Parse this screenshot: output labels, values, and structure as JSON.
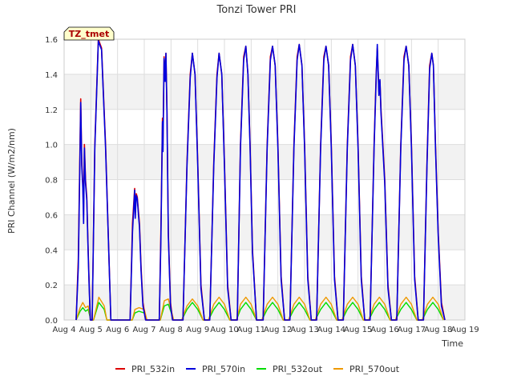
{
  "chart_data": {
    "type": "line",
    "title": "Tonzi Tower PRI",
    "xlabel": "Time",
    "ylabel": "PRI Channel (W/m2/nm)",
    "badge": "TZ_tmet",
    "xlim": [
      4,
      19
    ],
    "ylim": [
      0,
      1.6
    ],
    "x_ticks": [
      {
        "v": 4,
        "label": "Aug 4"
      },
      {
        "v": 5,
        "label": "Aug 5"
      },
      {
        "v": 6,
        "label": "Aug 6"
      },
      {
        "v": 7,
        "label": "Aug 7"
      },
      {
        "v": 8,
        "label": "Aug 8"
      },
      {
        "v": 9,
        "label": "Aug 9"
      },
      {
        "v": 10,
        "label": "Aug 10"
      },
      {
        "v": 11,
        "label": "Aug 11"
      },
      {
        "v": 12,
        "label": "Aug 12"
      },
      {
        "v": 13,
        "label": "Aug 13"
      },
      {
        "v": 14,
        "label": "Aug 14"
      },
      {
        "v": 15,
        "label": "Aug 15"
      },
      {
        "v": 16,
        "label": "Aug 16"
      },
      {
        "v": 17,
        "label": "Aug 17"
      },
      {
        "v": 18,
        "label": "Aug 18"
      },
      {
        "v": 19,
        "label": "Aug 19"
      }
    ],
    "y_ticks": [
      {
        "v": 0.0,
        "label": "0.0"
      },
      {
        "v": 0.2,
        "label": "0.2"
      },
      {
        "v": 0.4,
        "label": "0.4"
      },
      {
        "v": 0.6,
        "label": "0.6"
      },
      {
        "v": 0.8,
        "label": "0.8"
      },
      {
        "v": 1.0,
        "label": "1.0"
      },
      {
        "v": 1.2,
        "label": "1.2"
      },
      {
        "v": 1.4,
        "label": "1.4"
      },
      {
        "v": 1.6,
        "label": "1.6"
      }
    ],
    "grid": true,
    "legend_position": "bottom",
    "series": [
      {
        "name": "PRI_532in",
        "color": "#dd0000",
        "x": [
          4.45,
          4.53,
          4.6,
          4.62,
          4.66,
          4.7,
          4.73,
          4.76,
          4.8,
          4.85,
          4.9,
          4.94,
          4.98,
          5.05,
          5.15,
          5.28,
          5.4,
          5.55,
          5.75,
          5.9,
          6.02,
          6.15,
          6.47,
          6.56,
          6.64,
          6.66,
          6.7,
          6.74,
          6.78,
          6.82,
          6.88,
          6.95,
          7.05,
          7.56,
          7.62,
          7.68,
          7.7,
          7.74,
          7.78,
          7.81,
          7.85,
          7.9,
          7.98,
          8.06,
          8.45,
          8.6,
          8.72,
          8.8,
          8.9,
          9.0,
          9.12,
          9.25,
          9.45,
          9.6,
          9.72,
          9.8,
          9.9,
          10.0,
          10.12,
          10.25,
          10.48,
          10.6,
          10.72,
          10.8,
          10.88,
          10.96,
          11.05,
          11.2,
          11.45,
          11.6,
          11.72,
          11.8,
          11.9,
          12.0,
          12.12,
          12.25,
          12.45,
          12.6,
          12.72,
          12.8,
          12.9,
          13.0,
          13.12,
          13.25,
          13.45,
          13.6,
          13.72,
          13.8,
          13.9,
          14.0,
          14.12,
          14.25,
          14.45,
          14.6,
          14.72,
          14.8,
          14.9,
          15.0,
          15.12,
          15.25,
          15.45,
          15.6,
          15.68,
          15.72,
          15.78,
          15.82,
          15.86,
          16.0,
          16.12,
          16.25,
          16.45,
          16.6,
          16.72,
          16.8,
          16.9,
          17.0,
          17.12,
          17.25,
          17.45,
          17.58,
          17.68,
          17.76,
          17.82,
          17.9,
          18.0,
          18.12,
          18.25
        ],
        "y": [
          0,
          0.35,
          1.05,
          1.26,
          0.9,
          0.78,
          0.6,
          1.0,
          0.8,
          0.7,
          0.4,
          0.2,
          0,
          0,
          1.0,
          1.6,
          1.55,
          1.0,
          0,
          0,
          0,
          0,
          0,
          0.55,
          0.75,
          0.6,
          0.72,
          0.7,
          0.62,
          0.55,
          0.3,
          0.1,
          0,
          0,
          0.5,
          1.15,
          1.0,
          1.5,
          1.38,
          1.52,
          1.2,
          0.5,
          0.1,
          0,
          0,
          0.9,
          1.4,
          1.52,
          1.4,
          0.9,
          0.2,
          0,
          0,
          0.9,
          1.4,
          1.52,
          1.4,
          0.9,
          0.2,
          0,
          0,
          1.0,
          1.5,
          1.56,
          1.4,
          1.0,
          0.4,
          0,
          0,
          1.0,
          1.5,
          1.56,
          1.45,
          1.0,
          0.25,
          0,
          0,
          1.0,
          1.5,
          1.57,
          1.45,
          1.0,
          0.25,
          0,
          0,
          1.0,
          1.5,
          1.56,
          1.45,
          1.0,
          0.25,
          0,
          0,
          1.0,
          1.5,
          1.57,
          1.45,
          1.0,
          0.25,
          0,
          0,
          1.0,
          1.4,
          1.55,
          1.3,
          1.36,
          1.2,
          0.8,
          0.2,
          0,
          0,
          1.0,
          1.5,
          1.56,
          1.45,
          1.0,
          0.25,
          0,
          0,
          0.9,
          1.45,
          1.52,
          1.45,
          1.0,
          0.5,
          0.1,
          0
        ]
      },
      {
        "name": "PRI_570in",
        "color": "#0000dd",
        "x": [
          4.45,
          4.53,
          4.6,
          4.62,
          4.66,
          4.7,
          4.73,
          4.76,
          4.8,
          4.85,
          4.9,
          4.94,
          4.98,
          5.05,
          5.15,
          5.28,
          5.4,
          5.55,
          5.75,
          5.9,
          6.02,
          6.15,
          6.47,
          6.56,
          6.64,
          6.66,
          6.7,
          6.74,
          6.78,
          6.82,
          6.88,
          6.95,
          7.05,
          7.56,
          7.62,
          7.68,
          7.7,
          7.74,
          7.78,
          7.81,
          7.85,
          7.9,
          7.98,
          8.06,
          8.45,
          8.6,
          8.72,
          8.8,
          8.9,
          9.0,
          9.12,
          9.25,
          9.45,
          9.6,
          9.72,
          9.8,
          9.9,
          10.0,
          10.12,
          10.25,
          10.48,
          10.6,
          10.72,
          10.8,
          10.88,
          10.96,
          11.05,
          11.2,
          11.45,
          11.6,
          11.72,
          11.8,
          11.9,
          12.0,
          12.12,
          12.25,
          12.45,
          12.6,
          12.72,
          12.8,
          12.9,
          13.0,
          13.12,
          13.25,
          13.45,
          13.6,
          13.72,
          13.8,
          13.9,
          14.0,
          14.12,
          14.25,
          14.45,
          14.6,
          14.72,
          14.8,
          14.9,
          15.0,
          15.12,
          15.25,
          15.45,
          15.6,
          15.68,
          15.72,
          15.78,
          15.82,
          15.86,
          16.0,
          16.12,
          16.25,
          16.45,
          16.6,
          16.72,
          16.8,
          16.9,
          17.0,
          17.12,
          17.25,
          17.45,
          17.58,
          17.68,
          17.76,
          17.82,
          17.9,
          18.0,
          18.12,
          18.25
        ],
        "y": [
          0,
          0.3,
          1.0,
          1.24,
          0.88,
          0.75,
          0.55,
          0.98,
          0.78,
          0.68,
          0.38,
          0.18,
          0,
          0,
          0.98,
          1.59,
          1.54,
          0.98,
          0,
          0,
          0,
          0,
          0,
          0.5,
          0.74,
          0.58,
          0.71,
          0.69,
          0.6,
          0.53,
          0.28,
          0.08,
          0,
          0,
          0.45,
          1.13,
          0.96,
          1.49,
          1.36,
          1.52,
          1.18,
          0.48,
          0.08,
          0,
          0,
          0.88,
          1.38,
          1.52,
          1.4,
          0.88,
          0.18,
          0,
          0,
          0.88,
          1.38,
          1.52,
          1.4,
          0.88,
          0.18,
          0,
          0,
          0.98,
          1.48,
          1.56,
          1.4,
          0.98,
          0.38,
          0,
          0,
          0.98,
          1.48,
          1.56,
          1.45,
          0.98,
          0.23,
          0,
          0,
          0.98,
          1.48,
          1.57,
          1.45,
          0.98,
          0.23,
          0,
          0,
          0.98,
          1.48,
          1.56,
          1.45,
          0.98,
          0.23,
          0,
          0,
          0.98,
          1.48,
          1.57,
          1.45,
          0.98,
          0.23,
          0,
          0,
          0.98,
          1.38,
          1.57,
          1.28,
          1.37,
          1.18,
          0.78,
          0.18,
          0,
          0,
          0.98,
          1.48,
          1.56,
          1.45,
          0.98,
          0.23,
          0,
          0,
          0.88,
          1.43,
          1.52,
          1.45,
          0.98,
          0.48,
          0.08,
          0
        ]
      },
      {
        "name": "PRI_532out",
        "color": "#00dd00",
        "x": [
          4.45,
          4.6,
          4.7,
          4.8,
          4.9,
          5.0,
          5.1,
          5.3,
          5.5,
          5.6,
          6.55,
          6.65,
          6.8,
          7.0,
          7.1,
          7.6,
          7.75,
          7.9,
          8.1,
          8.4,
          8.6,
          8.8,
          9.0,
          9.2,
          9.4,
          9.6,
          9.8,
          10.0,
          10.2,
          10.45,
          10.6,
          10.8,
          11.0,
          11.2,
          11.4,
          11.6,
          11.8,
          12.0,
          12.2,
          12.4,
          12.6,
          12.8,
          13.0,
          13.2,
          13.4,
          13.6,
          13.8,
          14.0,
          14.2,
          14.4,
          14.6,
          14.8,
          15.0,
          15.2,
          15.4,
          15.6,
          15.8,
          16.0,
          16.2,
          16.4,
          16.6,
          16.8,
          17.0,
          17.2,
          17.4,
          17.6,
          17.8,
          18.0,
          18.2
        ],
        "y": [
          0,
          0.05,
          0.07,
          0.05,
          0.06,
          0,
          0,
          0.1,
          0.06,
          0,
          0,
          0.04,
          0.05,
          0.04,
          0,
          0,
          0.08,
          0.09,
          0,
          0,
          0.06,
          0.1,
          0.06,
          0,
          0,
          0.06,
          0.1,
          0.06,
          0,
          0,
          0.06,
          0.1,
          0.06,
          0,
          0,
          0.06,
          0.1,
          0.06,
          0,
          0,
          0.06,
          0.1,
          0.06,
          0,
          0,
          0.06,
          0.1,
          0.06,
          0,
          0,
          0.06,
          0.1,
          0.06,
          0,
          0,
          0.06,
          0.1,
          0.06,
          0,
          0,
          0.06,
          0.1,
          0.06,
          0,
          0,
          0.06,
          0.1,
          0.06,
          0
        ]
      },
      {
        "name": "PRI_570out",
        "color": "#ee9900",
        "x": [
          4.45,
          4.6,
          4.7,
          4.8,
          4.9,
          5.0,
          5.1,
          5.3,
          5.5,
          5.6,
          6.55,
          6.65,
          6.8,
          7.0,
          7.1,
          7.6,
          7.75,
          7.9,
          8.1,
          8.4,
          8.6,
          8.8,
          9.0,
          9.2,
          9.4,
          9.6,
          9.8,
          10.0,
          10.2,
          10.45,
          10.6,
          10.8,
          11.0,
          11.2,
          11.4,
          11.6,
          11.8,
          12.0,
          12.2,
          12.4,
          12.6,
          12.8,
          13.0,
          13.2,
          13.4,
          13.6,
          13.8,
          14.0,
          14.2,
          14.4,
          14.6,
          14.8,
          15.0,
          15.2,
          15.4,
          15.6,
          15.8,
          16.0,
          16.2,
          16.4,
          16.6,
          16.8,
          17.0,
          17.2,
          17.4,
          17.6,
          17.8,
          18.0,
          18.2
        ],
        "y": [
          0,
          0.07,
          0.1,
          0.07,
          0.08,
          0,
          0,
          0.13,
          0.08,
          0,
          0,
          0.06,
          0.07,
          0.06,
          0,
          0,
          0.11,
          0.12,
          0,
          0,
          0.08,
          0.12,
          0.08,
          0,
          0,
          0.09,
          0.13,
          0.09,
          0,
          0,
          0.09,
          0.13,
          0.09,
          0,
          0,
          0.09,
          0.13,
          0.09,
          0,
          0,
          0.09,
          0.13,
          0.09,
          0,
          0,
          0.09,
          0.13,
          0.09,
          0,
          0,
          0.09,
          0.13,
          0.09,
          0,
          0,
          0.09,
          0.13,
          0.09,
          0,
          0,
          0.09,
          0.13,
          0.09,
          0,
          0,
          0.09,
          0.13,
          0.09,
          0
        ]
      }
    ]
  }
}
